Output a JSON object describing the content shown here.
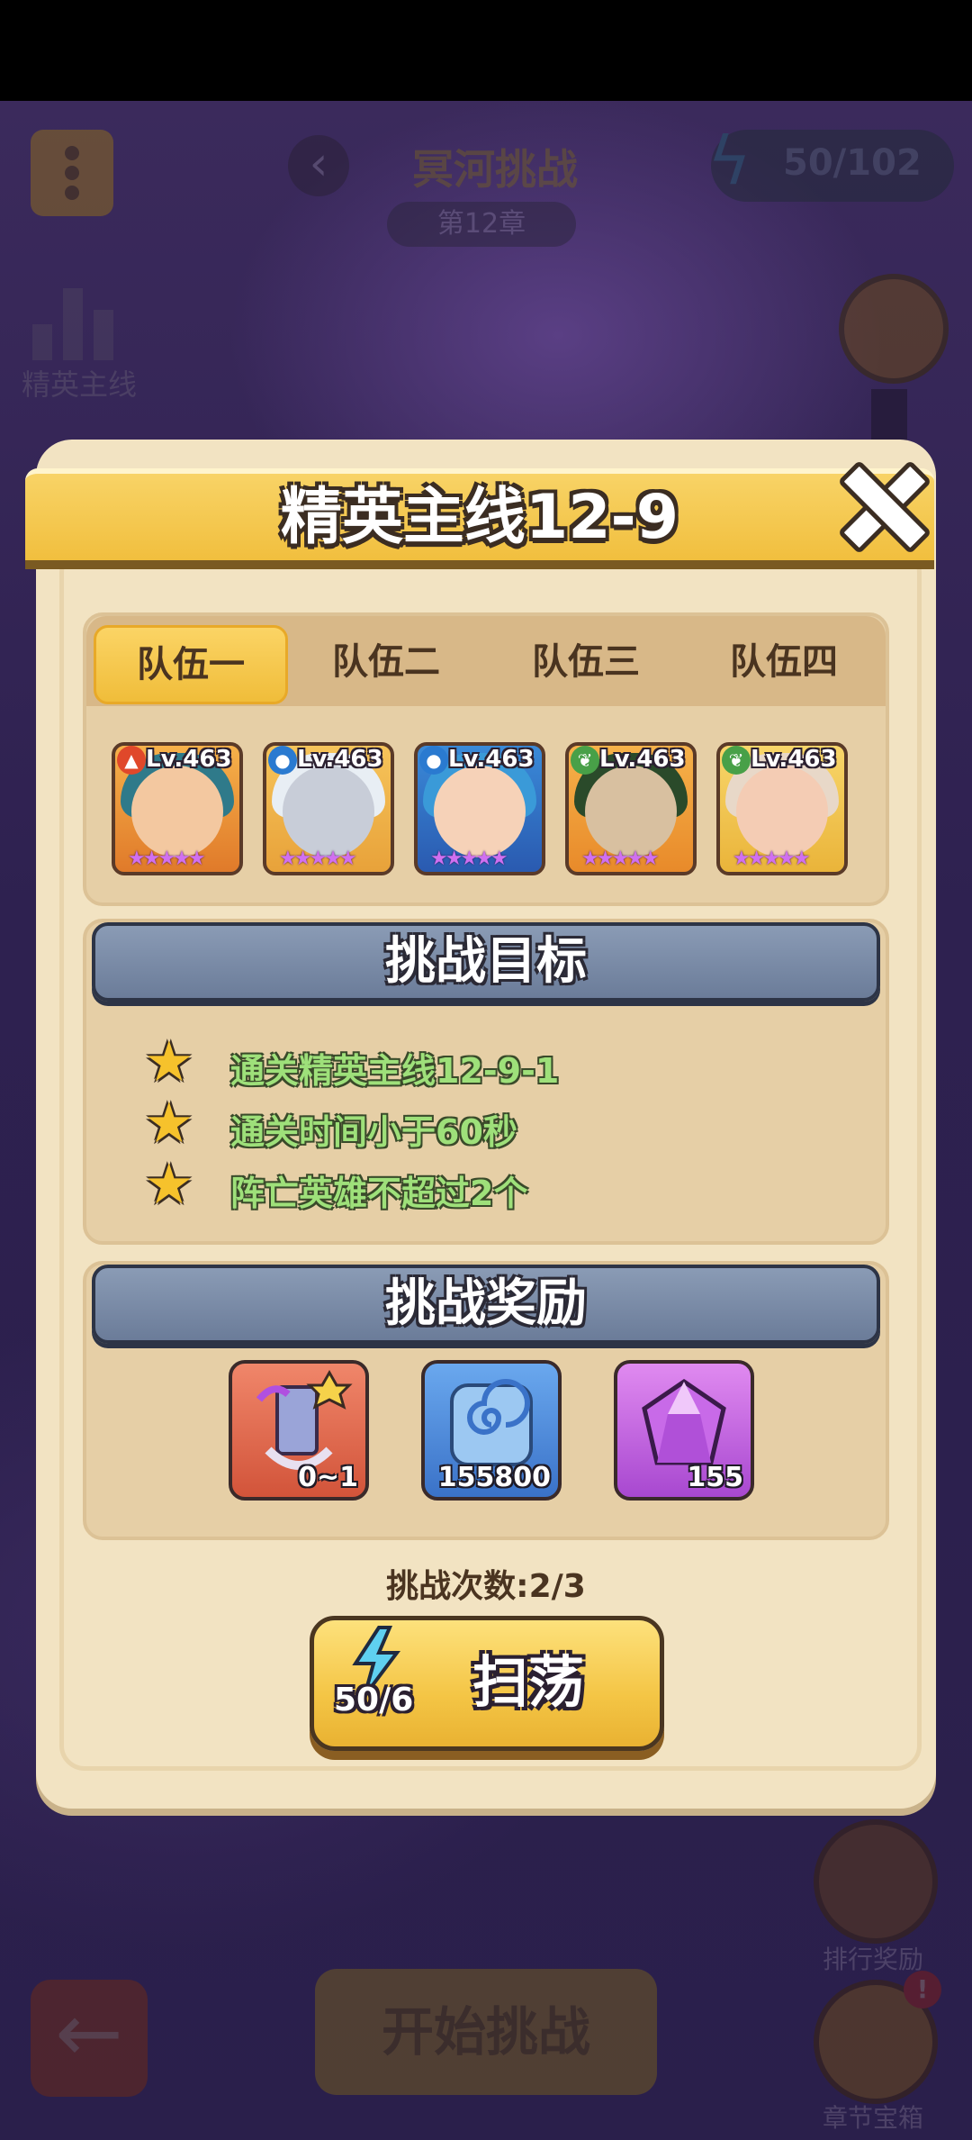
{
  "background": {
    "level_title": "冥河挑战",
    "chapter": "第12章",
    "energy": "50/102",
    "elite_label": "精英主线",
    "side_label_1": "排行奖励",
    "side_label_2": "章节宝箱",
    "notification_badge": "!",
    "start_button": "开始挑战"
  },
  "dialog": {
    "title": "精英主线12-9",
    "tabs": [
      "队伍一",
      "队伍二",
      "队伍三",
      "队伍四"
    ],
    "active_tab": 0,
    "heroes": [
      {
        "level": "Lv.463",
        "element": "fire",
        "stars": 5
      },
      {
        "level": "Lv.463",
        "element": "water",
        "stars": 5
      },
      {
        "level": "Lv.463",
        "element": "water",
        "stars": 5
      },
      {
        "level": "Lv.463",
        "element": "nature",
        "stars": 5
      },
      {
        "level": "Lv.463",
        "element": "nature",
        "stars": 5
      }
    ],
    "goals_header": "挑战目标",
    "goals": [
      "通关精英主线12-9-1",
      "通关时间小于60秒",
      "阵亡英雄不超过2个"
    ],
    "rewards_header": "挑战奖励",
    "rewards": [
      {
        "icon": "scroll-icon",
        "count": "0~1"
      },
      {
        "icon": "swirl-token-icon",
        "count": "155800"
      },
      {
        "icon": "purple-gem-icon",
        "count": "155"
      }
    ],
    "attempts_label": "挑战次数:",
    "attempts_value": "2/3",
    "sweep_cost": "50/6",
    "sweep_label": "扫荡"
  },
  "colors": {
    "banner": "#f1bf3e",
    "panel": "#f2e3c2",
    "section_header": "#7a8ba7",
    "goal_text": "#9ee07a",
    "sweep_button": "#f4c545"
  }
}
